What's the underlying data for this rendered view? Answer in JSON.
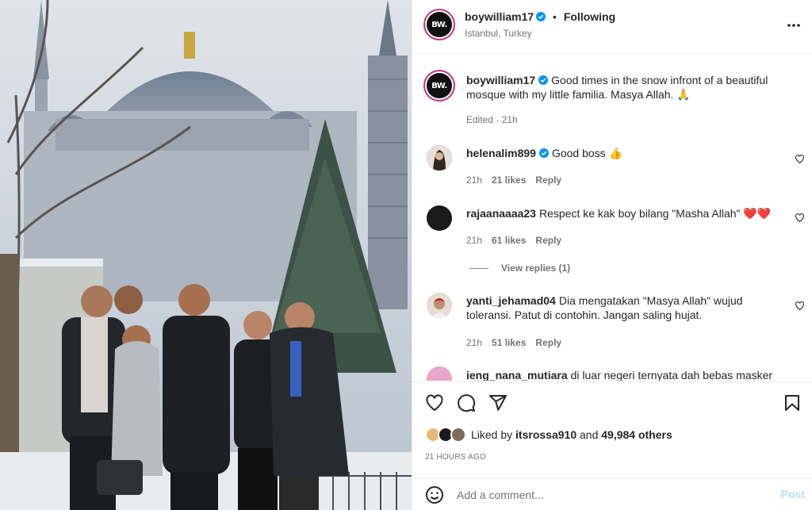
{
  "post": {
    "username": "boywilliam17",
    "follow_status": "Following",
    "location": "Istanbul, Turkey",
    "avatar_text": "BW.",
    "caption": "Good times in the snow infront of a beautiful mosque with my little familia. Masya Allah. 🙏",
    "caption_meta": "Edited · 21h"
  },
  "comments": [
    {
      "username": "helenalim899",
      "verified": true,
      "text": "Good boss 👍",
      "time": "21h",
      "likes": "21 likes",
      "reply": "Reply"
    },
    {
      "username": "rajaanaaaa23",
      "verified": false,
      "text": "Respect ke kak boy bilang \"Masha Allah\" ❤️❤️",
      "time": "21h",
      "likes": "61 likes",
      "reply": "Reply",
      "view_replies": "View replies (1)"
    },
    {
      "username": "yanti_jehamad04",
      "verified": false,
      "text": "Dia mengatakan \"Masya Allah\" wujud toleransi. Patut di contohin. Jangan saling hujat.",
      "time": "21h",
      "likes": "51 likes",
      "reply": "Reply"
    },
    {
      "username": "ieng_nana_mutiara",
      "verified": false,
      "text": "di luar negeri ternyata dah bebas masker"
    }
  ],
  "likes": {
    "prefix": "Liked by",
    "user": "itsrossa910",
    "middle": "and",
    "others": "49,984 others"
  },
  "time_ago": "21 HOURS AGO",
  "comment_box": {
    "placeholder": "Add a comment...",
    "post_label": "Post"
  },
  "icons": [
    "more-icon",
    "heart-icon",
    "comment-icon",
    "share-icon",
    "bookmark-icon",
    "emoji-icon",
    "verified-icon"
  ],
  "colors": {
    "verified": "#0095f6",
    "post_disabled": "#b2dffc",
    "muted": "#737373",
    "ring": "#c13584"
  }
}
